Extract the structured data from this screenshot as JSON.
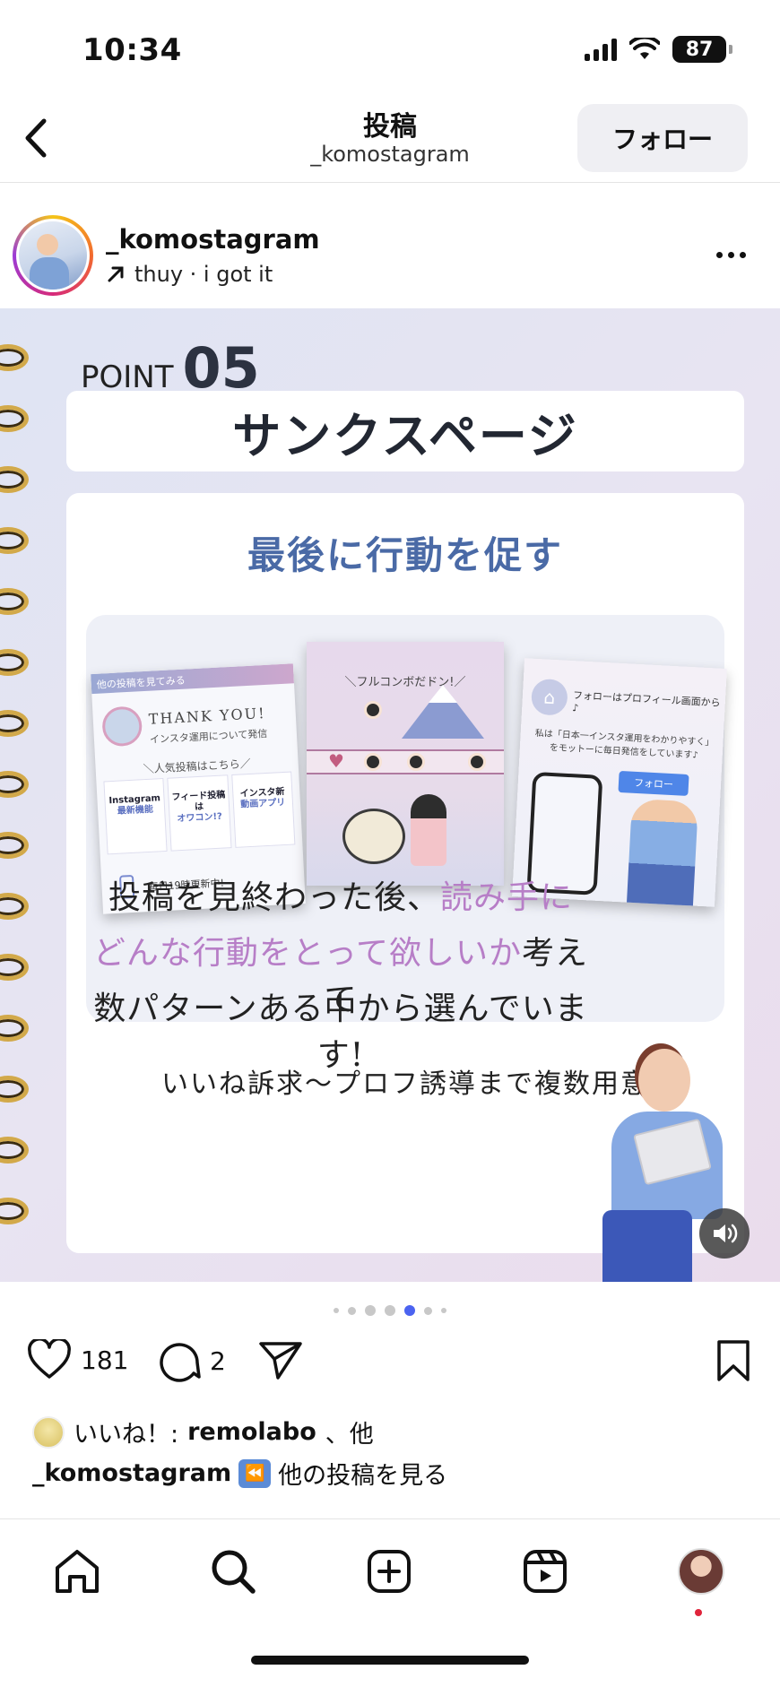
{
  "status_bar": {
    "time": "10:34",
    "battery": "87"
  },
  "header": {
    "title": "投稿",
    "subtitle": "_komostagram",
    "follow_label": "フォロー"
  },
  "post": {
    "username": "_komostagram",
    "audio": "thuy · i got it",
    "image": {
      "point_label": "POINT",
      "point_number": "05",
      "title": "サンクスページ",
      "heading": "最後に行動を促す",
      "thumbs": {
        "t1_banner": "他の投稿を見てみる",
        "t1_thanks": "THANK YOU!",
        "t1_sub": "インスタ運用について発信",
        "t1_popular": "＼人気投稿はこちら／",
        "t1_cards": [
          {
            "line1": "Instagram",
            "line2": "最新機能"
          },
          {
            "line1": "フィード投稿は",
            "line2": "オワコン!?"
          },
          {
            "line1": "インスタ新",
            "line2": "動画アプリ"
          }
        ],
        "t1_daily": "毎日19時更新中!",
        "t2_title": "＼フルコンボだドン!／",
        "t3_text1": "フォローはプロフィール画面から♪",
        "t3_text2": "私は「日本一インスタ運用をわかりやすく」をモットーに毎日発信をしています♪",
        "t3_follow": "フォロー"
      },
      "panel_caption": "いいね訴求〜プロフ誘導まで複数用意",
      "message": {
        "line1_a": "投稿を見終わった後、",
        "line1_b": "読み手に",
        "line2_a": "どんな行動をとって欲しいか",
        "line2_b": "考えて",
        "line3": "数パターンある中から選んでいます!"
      }
    },
    "carousel": {
      "count": 7,
      "active_index": 4
    },
    "likes_count": "181",
    "comments_count": "2",
    "likes_text_prefix": "いいね！: ",
    "likes_text_user": "remolabo",
    "likes_text_suffix": "、他",
    "caption_user": "_komostagram",
    "caption_text": "他の投稿を見る"
  },
  "colors": {
    "accent_blue": "#4b63f0",
    "heading_blue": "#4a6aa6",
    "accent_purple": "#b77ec7"
  },
  "tab_bar": {
    "items": [
      "home-icon",
      "search-icon",
      "create-icon",
      "reels-icon",
      "profile-avatar"
    ]
  }
}
